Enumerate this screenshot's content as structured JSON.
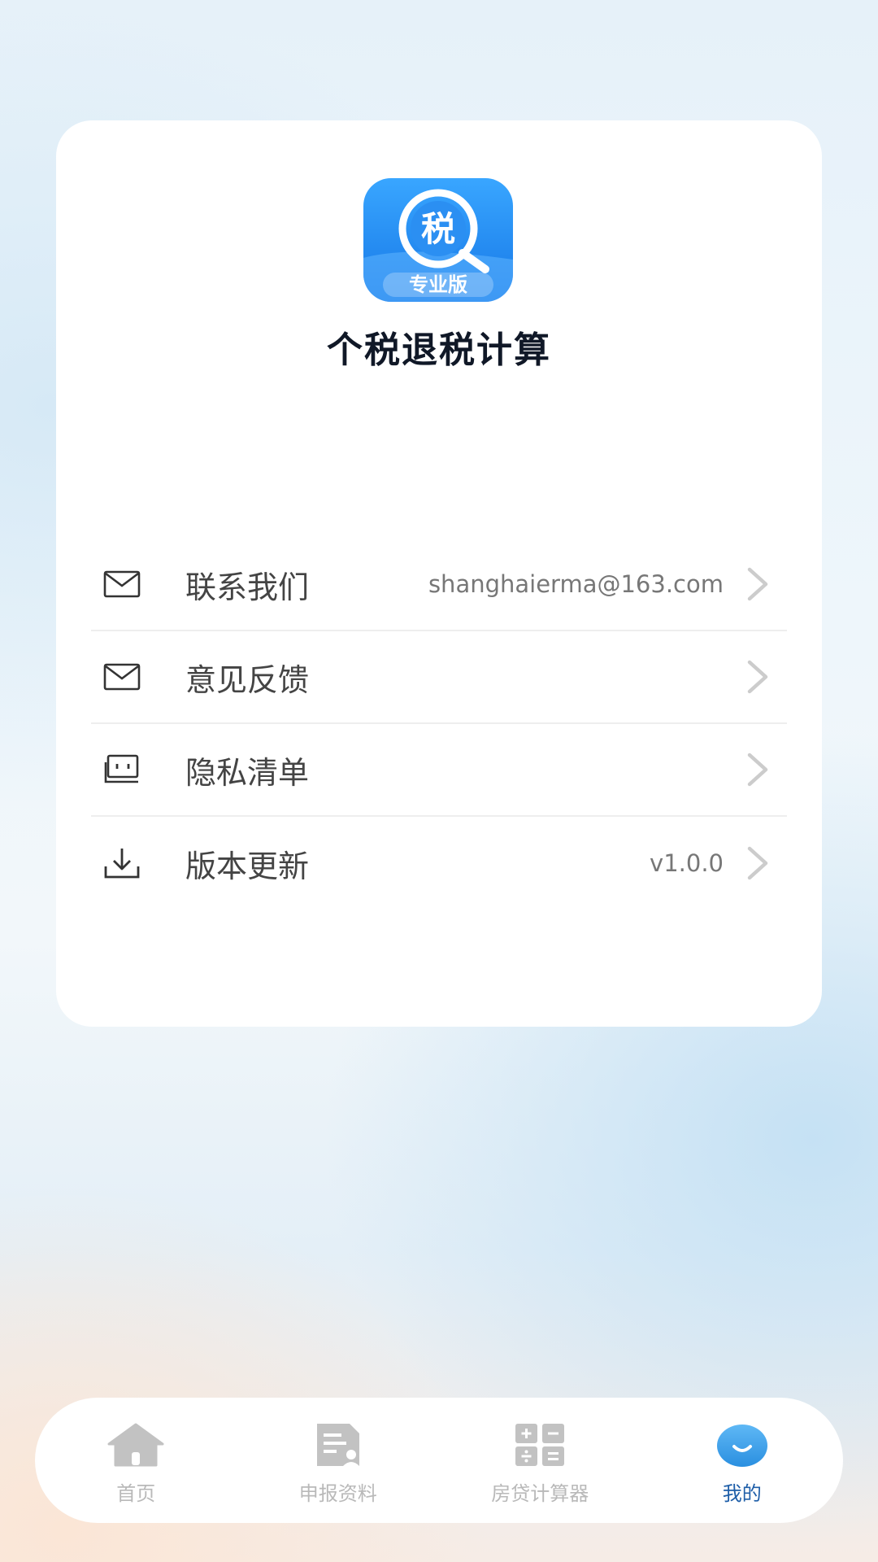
{
  "app": {
    "logo_char": "税",
    "logo_sub": "专业版",
    "title": "个税退税计算"
  },
  "menu": [
    {
      "label": "联系我们",
      "value": "shanghaierma@163.com",
      "icon": "mail-icon"
    },
    {
      "label": "意见反馈",
      "value": "",
      "icon": "mail-icon"
    },
    {
      "label": "隐私清单",
      "value": "",
      "icon": "message-icon"
    },
    {
      "label": "版本更新",
      "value": "v1.0.0",
      "icon": "download-icon"
    }
  ],
  "tabbar": [
    {
      "label": "首页",
      "icon": "home-icon",
      "active": false
    },
    {
      "label": "申报资料",
      "icon": "document-icon",
      "active": false
    },
    {
      "label": "房贷计算器",
      "icon": "calculator-icon",
      "active": false
    },
    {
      "label": "我的",
      "icon": "profile-icon",
      "active": true
    }
  ],
  "colors": {
    "accent": "#1e5ea8",
    "logo_blue": "#1f8df0",
    "tab_inactive": "#b9b9b9"
  }
}
